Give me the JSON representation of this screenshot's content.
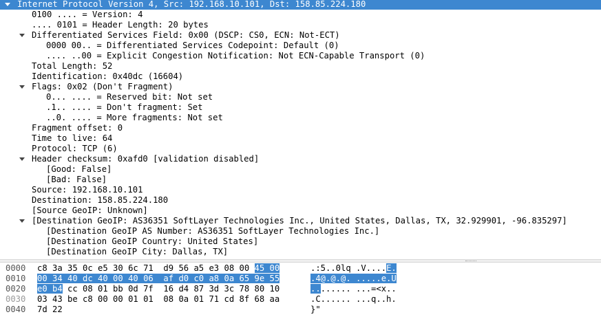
{
  "tree": [
    {
      "text": "Internet Protocol Version 4, Src: 192.168.10.101, Dst: 158.85.224.180",
      "depth": 0,
      "expandable": true,
      "selected": true
    },
    {
      "text": "0100 .... = Version: 4",
      "depth": 1
    },
    {
      "text": ".... 0101 = Header Length: 20 bytes",
      "depth": 1
    },
    {
      "text": "Differentiated Services Field: 0x00 (DSCP: CS0, ECN: Not-ECT)",
      "depth": 1,
      "expandable": true
    },
    {
      "text": "0000 00.. = Differentiated Services Codepoint: Default (0)",
      "depth": 2
    },
    {
      "text": ".... ..00 = Explicit Congestion Notification: Not ECN-Capable Transport (0)",
      "depth": 2
    },
    {
      "text": "Total Length: 52",
      "depth": 1
    },
    {
      "text": "Identification: 0x40dc (16604)",
      "depth": 1
    },
    {
      "text": "Flags: 0x02 (Don't Fragment)",
      "depth": 1,
      "expandable": true
    },
    {
      "text": "0... .... = Reserved bit: Not set",
      "depth": 2
    },
    {
      "text": ".1.. .... = Don't fragment: Set",
      "depth": 2
    },
    {
      "text": "..0. .... = More fragments: Not set",
      "depth": 2
    },
    {
      "text": "Fragment offset: 0",
      "depth": 1
    },
    {
      "text": "Time to live: 64",
      "depth": 1
    },
    {
      "text": "Protocol: TCP (6)",
      "depth": 1
    },
    {
      "text": "Header checksum: 0xafd0 [validation disabled]",
      "depth": 1,
      "expandable": true
    },
    {
      "text": "[Good: False]",
      "depth": 2
    },
    {
      "text": "[Bad: False]",
      "depth": 2
    },
    {
      "text": "Source: 192.168.10.101",
      "depth": 1
    },
    {
      "text": "Destination: 158.85.224.180",
      "depth": 1
    },
    {
      "text": "[Source GeoIP: Unknown]",
      "depth": 1
    },
    {
      "text": "[Destination GeoIP: AS36351 SoftLayer Technologies Inc., United States, Dallas, TX, 32.929901, -96.835297]",
      "depth": 1,
      "expandable": true
    },
    {
      "text": "[Destination GeoIP AS Number: AS36351 SoftLayer Technologies Inc.]",
      "depth": 2
    },
    {
      "text": "[Destination GeoIP Country: United States]",
      "depth": 2
    },
    {
      "text": "[Destination GeoIP City: Dallas, TX]",
      "depth": 2
    }
  ],
  "hexdump": [
    {
      "offset": "0000",
      "hex": [
        {
          "t": "c8 3a 35 0c e5 30 6c 71  d9 56 a5 e3 08 00 "
        },
        {
          "t": "45 00",
          "hl": true
        }
      ],
      "ascii": [
        {
          "t": ".:5..0lq .V...."
        },
        {
          "t": "E.",
          "hl": true
        }
      ]
    },
    {
      "offset": "0010",
      "hex": [
        {
          "t": "00 34 40 dc 40 00 40 06  af d0 c0 a8 0a 65 9e 55",
          "hl": true
        }
      ],
      "ascii": [
        {
          "t": ".4@.@.@. .....e.U",
          "hl": true
        }
      ]
    },
    {
      "offset": "0020",
      "hex": [
        {
          "t": "e0 b4",
          "hl": true
        },
        {
          "t": " cc 08 01 bb 0d 7f  16 d4 87 3d 3c 78 80 10"
        }
      ],
      "ascii": [
        {
          "t": "..",
          "hl": true
        },
        {
          "t": "...... ...=<x.."
        }
      ]
    },
    {
      "offset": "0030",
      "dim": true,
      "hex": [
        {
          "t": "03 43 be c8 00 00 01 01  08 0a 01 71 cd 8f 68 aa"
        }
      ],
      "ascii": [
        {
          "t": ".C...... ...q..h."
        }
      ]
    },
    {
      "offset": "0040",
      "hex": [
        {
          "t": "7d 22"
        }
      ],
      "ascii": [
        {
          "t": "}\""
        }
      ]
    }
  ]
}
